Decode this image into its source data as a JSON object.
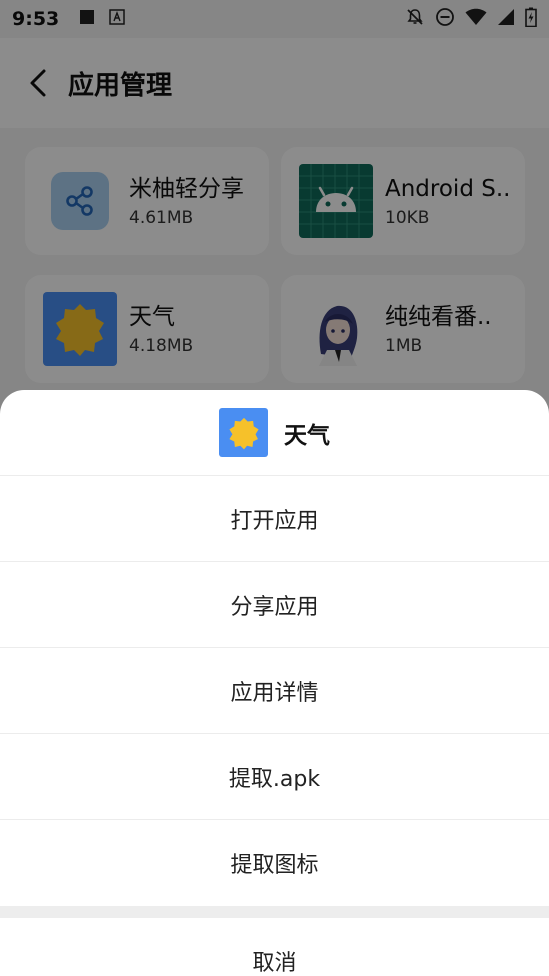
{
  "status_bar": {
    "time": "9:53",
    "icons": [
      "square-notification-icon",
      "a-notification-icon",
      "bell-off-icon",
      "do-not-disturb-icon",
      "wifi-icon",
      "signal-icon",
      "battery-charging-icon"
    ]
  },
  "header": {
    "title": "应用管理"
  },
  "apps": [
    {
      "name": "米柚轻分享",
      "size": "4.61MB",
      "icon": "share-icon"
    },
    {
      "name": "Android S..",
      "size": "10KB",
      "icon": "android-icon"
    },
    {
      "name": "天气",
      "size": "4.18MB",
      "icon": "weather-sun-icon"
    },
    {
      "name": "纯纯看番..",
      "size": "1MB",
      "icon": "anime-character-icon"
    }
  ],
  "sheet": {
    "title": "天气",
    "menu": [
      {
        "label": "打开应用"
      },
      {
        "label": "分享应用"
      },
      {
        "label": "应用详情"
      },
      {
        "label": "提取.apk"
      },
      {
        "label": "提取图标"
      }
    ],
    "cancel": "取消"
  },
  "colors": {
    "accent_blue": "#4a8ef2",
    "sun_yellow": "#f6c12a",
    "android_green": "#0f6b5a",
    "share_blue": "#a9d0f0"
  }
}
